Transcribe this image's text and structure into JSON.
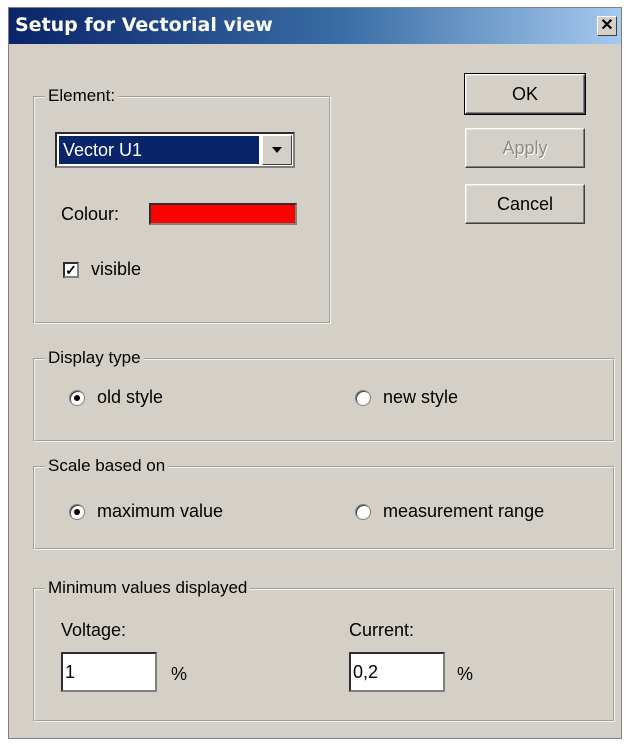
{
  "window": {
    "title": "Setup for Vectorial view",
    "close_glyph": "✕"
  },
  "buttons": {
    "ok": "OK",
    "apply": "Apply",
    "cancel": "Cancel"
  },
  "element_group": {
    "legend": "Element:",
    "selected": "Vector U1",
    "colour_label": "Colour:",
    "colour_value": "#ff0000",
    "visible_label": "visible",
    "visible_checked": true
  },
  "display_type": {
    "legend": "Display type",
    "options": [
      "old style",
      "new style"
    ],
    "selected_index": 0
  },
  "scale": {
    "legend": "Scale based on",
    "options": [
      "maximum value",
      "measurement range"
    ],
    "selected_index": 0
  },
  "minimum": {
    "legend": "Minimum values displayed",
    "voltage_label": "Voltage:",
    "voltage_value": "1",
    "voltage_unit": "%",
    "current_label": "Current:",
    "current_value": "0,2",
    "current_unit": "%"
  }
}
